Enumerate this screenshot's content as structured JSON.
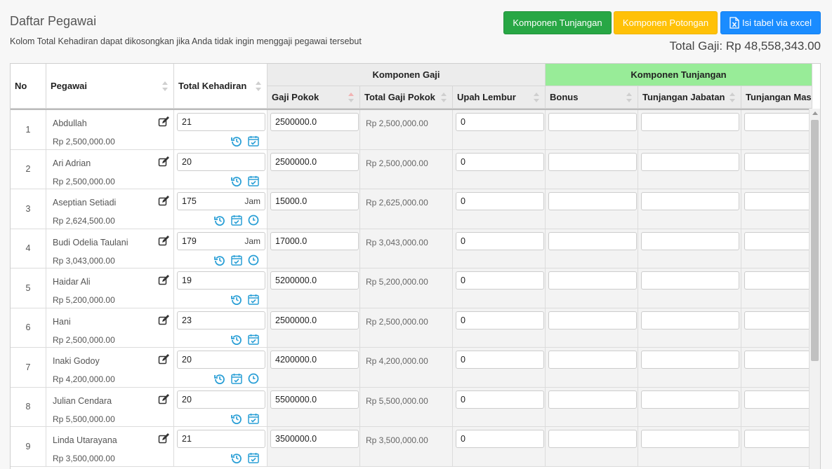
{
  "header": {
    "title": "Daftar Pegawai",
    "subtitle": "Kolom Total Kehadiran dapat dikosongkan jika Anda tidak ingin menggaji pegawai tersebut",
    "btn_tunjangan": "Komponen Tunjangan",
    "btn_potongan": "Komponen Potongan",
    "btn_excel": "Isi tabel via excel",
    "total_gaji": "Total Gaji: Rp 48,558,343.00"
  },
  "columns": {
    "no": "No",
    "pegawai": "Pegawai",
    "total_kehadiran": "Total Kehadiran",
    "komponen_gaji": "Komponen Gaji",
    "komponen_tunjangan": "Komponen Tunjangan",
    "gaji_pokok": "Gaji Pokok",
    "total_gaji_pokok": "Total Gaji Pokok",
    "upah_lembur": "Upah Lembur",
    "bonus": "Bonus",
    "tunjangan_jabatan": "Tunjangan Jabatan",
    "tunjangan_masa": "Tunjangan Mas"
  },
  "rows": [
    {
      "no": "1",
      "name": "Abdullah",
      "salary": "Rp 2,500,000.00",
      "kehadiran": "21",
      "unit": "",
      "gaji_pokok": "2500000.0",
      "total_gaji_pokok": "Rp 2,500,000.00",
      "upah_lembur": "0",
      "clock": false
    },
    {
      "no": "2",
      "name": "Ari Adrian",
      "salary": "Rp 2,500,000.00",
      "kehadiran": "20",
      "unit": "",
      "gaji_pokok": "2500000.0",
      "total_gaji_pokok": "Rp 2,500,000.00",
      "upah_lembur": "0",
      "clock": false
    },
    {
      "no": "3",
      "name": "Aseptian Setiadi",
      "salary": "Rp 2,624,500.00",
      "kehadiran": "175",
      "unit": "Jam",
      "gaji_pokok": "15000.0",
      "total_gaji_pokok": "Rp 2,625,000.00",
      "upah_lembur": "0",
      "clock": true
    },
    {
      "no": "4",
      "name": "Budi Odelia Taulani",
      "salary": "Rp 3,043,000.00",
      "kehadiran": "179",
      "unit": "Jam",
      "gaji_pokok": "17000.0",
      "total_gaji_pokok": "Rp 3,043,000.00",
      "upah_lembur": "0",
      "clock": true
    },
    {
      "no": "5",
      "name": "Haidar Ali",
      "salary": "Rp 5,200,000.00",
      "kehadiran": "19",
      "unit": "",
      "gaji_pokok": "5200000.0",
      "total_gaji_pokok": "Rp 5,200,000.00",
      "upah_lembur": "0",
      "clock": false
    },
    {
      "no": "6",
      "name": "Hani",
      "salary": "Rp 2,500,000.00",
      "kehadiran": "23",
      "unit": "",
      "gaji_pokok": "2500000.0",
      "total_gaji_pokok": "Rp 2,500,000.00",
      "upah_lembur": "0",
      "clock": false
    },
    {
      "no": "7",
      "name": "Inaki Godoy",
      "salary": "Rp 4,200,000.00",
      "kehadiran": "20",
      "unit": "",
      "gaji_pokok": "4200000.0",
      "total_gaji_pokok": "Rp 4,200,000.00",
      "upah_lembur": "0",
      "clock": true
    },
    {
      "no": "8",
      "name": "Julian Cendara",
      "salary": "Rp 5,500,000.00",
      "kehadiran": "20",
      "unit": "",
      "gaji_pokok": "5500000.0",
      "total_gaji_pokok": "Rp 5,500,000.00",
      "upah_lembur": "0",
      "clock": false
    },
    {
      "no": "9",
      "name": "Linda Utarayana",
      "salary": "Rp 3,500,000.00",
      "kehadiran": "21",
      "unit": "",
      "gaji_pokok": "3500000.0",
      "total_gaji_pokok": "Rp 3,500,000.00",
      "upah_lembur": "0",
      "clock": false
    }
  ],
  "colors": {
    "green": "#28a745",
    "yellow": "#ffc107",
    "blue": "#1a8cff",
    "tunjangan_header": "#98ec98",
    "icon": "#2a9fd6"
  },
  "icons": {
    "edit": "edit-icon",
    "history": "history-icon",
    "calendar": "calendar-check-icon",
    "clock": "clock-icon",
    "excel": "excel-file-icon"
  }
}
